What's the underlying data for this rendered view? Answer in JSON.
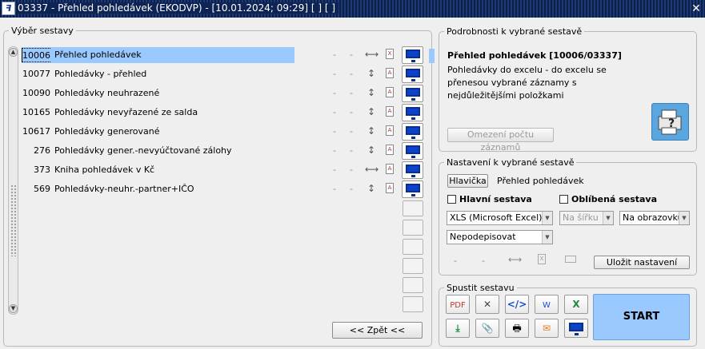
{
  "window": {
    "title": "03337 - Přehled pohledávek (EKODVP) - [10.01.2024; 09:29]  [ ]  [ ]",
    "app_icon": "ekonom-app-icon",
    "close_label": "✕"
  },
  "list": {
    "legend": "Výběr sestavy",
    "rows": [
      {
        "num": "10006",
        "label": "Přehled pohledávek",
        "d1": "-",
        "d2": "-",
        "orientation": "⟷",
        "file": "xls"
      },
      {
        "num": "10077",
        "label": "Pohledávky - přehled",
        "d1": "-",
        "d2": "-",
        "orientation": "↕",
        "file": "pdf"
      },
      {
        "num": "10090",
        "label": "Pohledávky neuhrazené",
        "d1": "-",
        "d2": "-",
        "orientation": "↕",
        "file": "pdf"
      },
      {
        "num": "10165",
        "label": "Pohledávky nevyřazené ze salda",
        "d1": "-",
        "d2": "-",
        "orientation": "↕",
        "file": "pdf"
      },
      {
        "num": "10617",
        "label": "Pohledávky generované",
        "d1": "-",
        "d2": "-",
        "orientation": "↕",
        "file": "pdf"
      },
      {
        "num": "276",
        "label": "Pohledávky gener.-nevyúčtované zálohy",
        "d1": "-",
        "d2": "-",
        "orientation": "↕",
        "file": "pdf"
      },
      {
        "num": "373",
        "label": "Kniha pohledávek v Kč",
        "d1": "-",
        "d2": "-",
        "orientation": "⟷",
        "file": "pdf"
      },
      {
        "num": "569",
        "label": "Pohledávky-neuhr.-partner+IČO",
        "d1": "-",
        "d2": "-",
        "orientation": "↕",
        "file": "pdf"
      }
    ],
    "back_button": "<< Zpět <<"
  },
  "details": {
    "legend": "Podrobnosti k vybrané sestavě",
    "name": "Přehled pohledávek [10006/03337]",
    "description": "Pohledávky do excelu - do excelu se přenesou vybrané záznamy s nejdůležitějšími položkami",
    "limit_button": "Omezení počtu záznamů",
    "help_icon": "printer-help-icon"
  },
  "settings": {
    "legend": "Nastavení k vybrané sestavě",
    "header_button": "Hlavička",
    "header_value": "Přehled pohledávek",
    "main_report_label": "Hlavní sestava",
    "favorite_label": "Oblíbená sestava",
    "format_value": "XLS (Microsoft Excel)",
    "orientation_value": "Na šířku",
    "output_value": "Na obrazovku",
    "sign_value": "Nepodepisovat",
    "dash1": "-",
    "dash2": "-",
    "save_button": "Uložit nastavení"
  },
  "run": {
    "legend": "Spustit sestavu",
    "start_label": "START",
    "tools": [
      "pdf-icon",
      "xml-icon",
      "code-icon",
      "word-icon",
      "excel-icon",
      "download-icon",
      "attachment-icon",
      "printer-icon",
      "email-icon",
      "monitor-icon"
    ]
  },
  "colors": {
    "selection": "#99c9ff",
    "titlebar": "#0e2455",
    "monitor_blue": "#0a43c9"
  }
}
